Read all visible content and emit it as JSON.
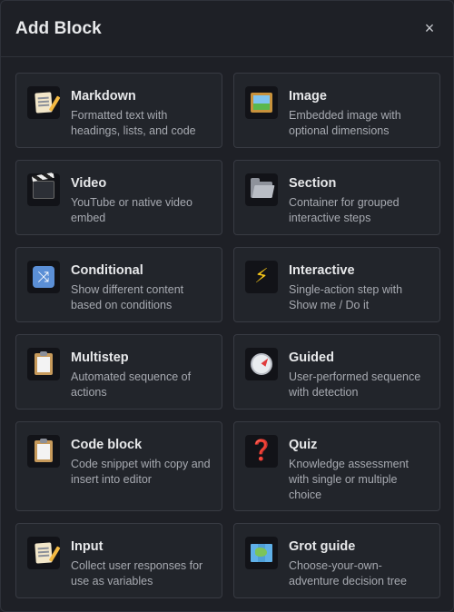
{
  "header": {
    "title": "Add Block",
    "close_glyph": "×"
  },
  "blocks": [
    {
      "name": "Markdown",
      "desc": "Formatted text with headings, lists, and code",
      "icon": "memo-icon"
    },
    {
      "name": "Image",
      "desc": "Embedded image with optional dimensions",
      "icon": "framed-picture-icon"
    },
    {
      "name": "Video",
      "desc": "YouTube or native video embed",
      "icon": "clapper-board-icon"
    },
    {
      "name": "Section",
      "desc": "Container for grouped interactive steps",
      "icon": "open-folder-icon"
    },
    {
      "name": "Conditional",
      "desc": "Show different content based on conditions",
      "icon": "shuffle-icon",
      "icon_glyph": "⤨"
    },
    {
      "name": "Interactive",
      "desc": "Single-action step with Show me / Do it",
      "icon": "lightning-icon",
      "icon_glyph": "⚡"
    },
    {
      "name": "Multistep",
      "desc": "Automated sequence of actions",
      "icon": "clipboard-icon"
    },
    {
      "name": "Guided",
      "desc": "User-performed sequence with detection",
      "icon": "compass-icon"
    },
    {
      "name": "Code block",
      "desc": "Code snippet with copy and insert into editor",
      "icon": "clipboard-icon"
    },
    {
      "name": "Quiz",
      "desc": "Knowledge assessment with single or multiple choice",
      "icon": "question-mark-icon",
      "icon_glyph": "❓"
    },
    {
      "name": "Input",
      "desc": "Collect user responses for use as variables",
      "icon": "memo-icon"
    },
    {
      "name": "Grot guide",
      "desc": "Choose-your-own-adventure decision tree",
      "icon": "world-map-icon"
    }
  ]
}
